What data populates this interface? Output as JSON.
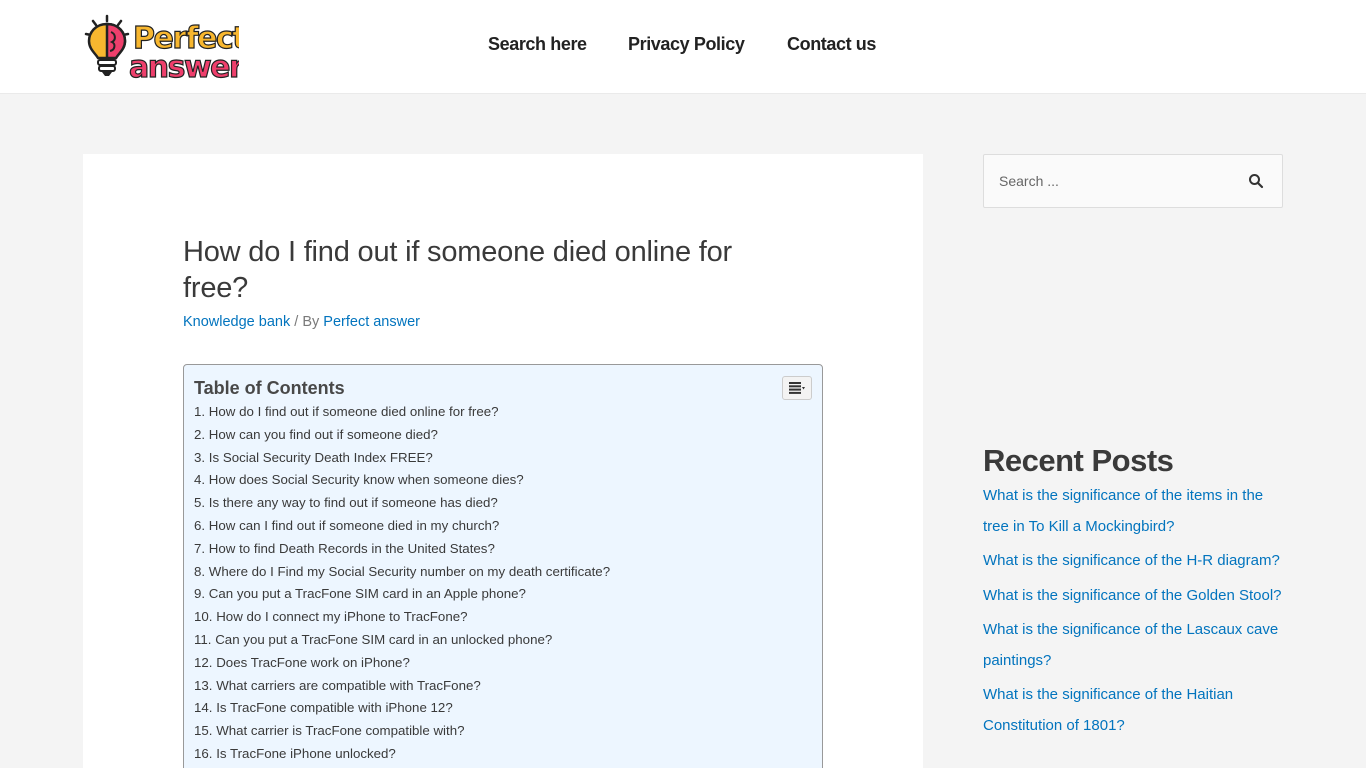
{
  "header": {
    "logo_text_top": "Perfect",
    "logo_text_bottom": "answer",
    "nav": [
      {
        "label": "Search here"
      },
      {
        "label": "Privacy Policy"
      },
      {
        "label": "Contact us"
      }
    ]
  },
  "article": {
    "title": "How do I find out if someone died online for free?",
    "category": "Knowledge bank",
    "by_separator": " / By ",
    "author": "Perfect answer"
  },
  "toc": {
    "title": "Table of Contents",
    "toggle_icon": "list-toggle-icon",
    "items": [
      {
        "num": "1.",
        "label": "How do I find out if someone died online for free?"
      },
      {
        "num": "2.",
        "label": "How can you find out if someone died?"
      },
      {
        "num": "3.",
        "label": "Is Social Security Death Index FREE?"
      },
      {
        "num": "4.",
        "label": "How does Social Security know when someone dies?"
      },
      {
        "num": "5.",
        "label": "Is there any way to find out if someone has died?"
      },
      {
        "num": "6.",
        "label": "How can I find out if someone died in my church?"
      },
      {
        "num": "7.",
        "label": "How to find Death Records in the United States?"
      },
      {
        "num": "8.",
        "label": "Where do I Find my Social Security number on my death certificate?"
      },
      {
        "num": "9.",
        "label": "Can you put a TracFone SIM card in an Apple phone?"
      },
      {
        "num": "10.",
        "label": "How do I connect my iPhone to TracFone?"
      },
      {
        "num": "11.",
        "label": "Can you put a TracFone SIM card in an unlocked phone?"
      },
      {
        "num": "12.",
        "label": "Does TracFone work on iPhone?"
      },
      {
        "num": "13.",
        "label": "What carriers are compatible with TracFone?"
      },
      {
        "num": "14.",
        "label": "Is TracFone compatible with iPhone 12?"
      },
      {
        "num": "15.",
        "label": "What carrier is TracFone compatible with?"
      },
      {
        "num": "16.",
        "label": "Is TracFone iPhone unlocked?"
      }
    ]
  },
  "sidebar": {
    "search_placeholder": "Search ...",
    "recent_title": "Recent Posts",
    "recent_posts": [
      {
        "label": "What is the significance of the items in the tree in To Kill a Mockingbird?"
      },
      {
        "label": "What is the significance of the H-R diagram?"
      },
      {
        "label": "What is the significance of the Golden Stool?"
      },
      {
        "label": "What is the significance of the Lascaux cave paintings?"
      },
      {
        "label": "What is the significance of the Haitian Constitution of 1801?"
      }
    ]
  },
  "colors": {
    "link": "#0274be",
    "logo_yellow": "#f8b72f",
    "logo_pink": "#ee3f6c",
    "toc_bg": "#edf6ff"
  }
}
